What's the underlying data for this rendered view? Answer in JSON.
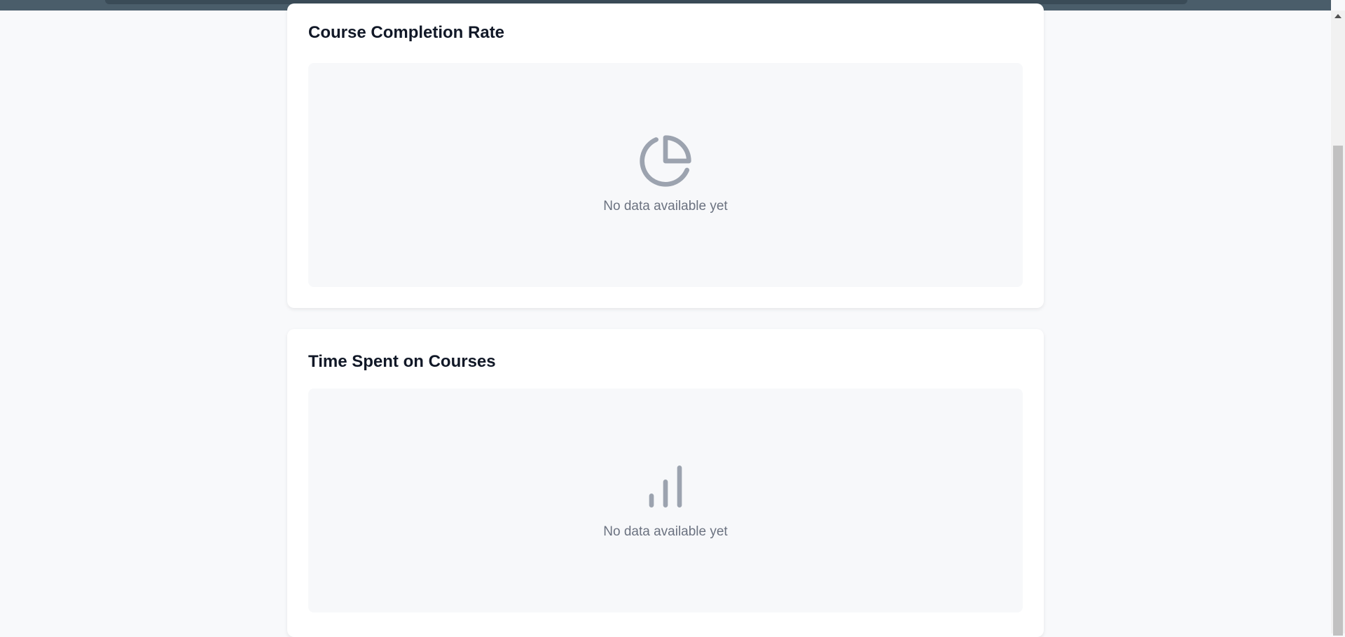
{
  "cards": [
    {
      "title": "Course Completion Rate",
      "empty_icon": "pie-chart-icon",
      "empty_text": "No data available yet"
    },
    {
      "title": "Time Spent on Courses",
      "empty_icon": "bar-chart-icon",
      "empty_text": "No data available yet"
    }
  ],
  "colors": {
    "icon": "#9ca3af",
    "empty_text": "#6b7280",
    "title": "#111827",
    "card_bg": "#ffffff",
    "chart_bg": "#f7f8fa"
  }
}
